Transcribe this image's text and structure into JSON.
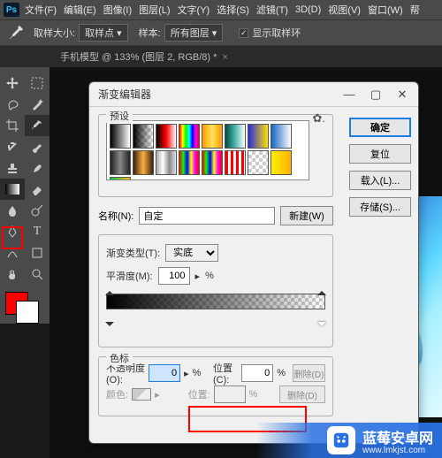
{
  "menubar": {
    "items": [
      "文件(F)",
      "编辑(E)",
      "图像(I)",
      "图层(L)",
      "文字(Y)",
      "选择(S)",
      "滤镜(T)",
      "3D(D)",
      "视图(V)",
      "窗口(W)",
      "帮"
    ]
  },
  "optbar": {
    "sample_size_label": "取样大小:",
    "sample_size_value": "取样点",
    "sample_label": "样本:",
    "sample_value": "所有图层",
    "show_ring_label": "显示取样环"
  },
  "doctab": {
    "label": "手机模型 @ 133% (图层 2, RGB/8) *"
  },
  "dialog": {
    "title": "渐变编辑器",
    "presets_label": "预设",
    "btn_ok": "确定",
    "btn_reset": "复位",
    "btn_load": "载入(L)...",
    "btn_save": "存储(S)...",
    "name_label": "名称(N):",
    "name_value": "自定",
    "btn_new": "新建(W)",
    "type_label": "渐变类型(T):",
    "type_value": "实底",
    "smooth_label": "平滑度(M):",
    "smooth_value": "100",
    "stops_label": "色标",
    "opacity_label": "不透明度(O):",
    "opacity_value": "0",
    "location_label": "位置(C):",
    "location_value": "0",
    "color_label": "颜色:",
    "location2_label": "位置:",
    "delete_label": "删除(D)",
    "percent": "%"
  },
  "wm": {
    "text": "蓝莓安卓网",
    "url": "www.lmkjst.com"
  },
  "colors": {
    "accent": "#1e7de0",
    "highlight": "#ff0000"
  }
}
